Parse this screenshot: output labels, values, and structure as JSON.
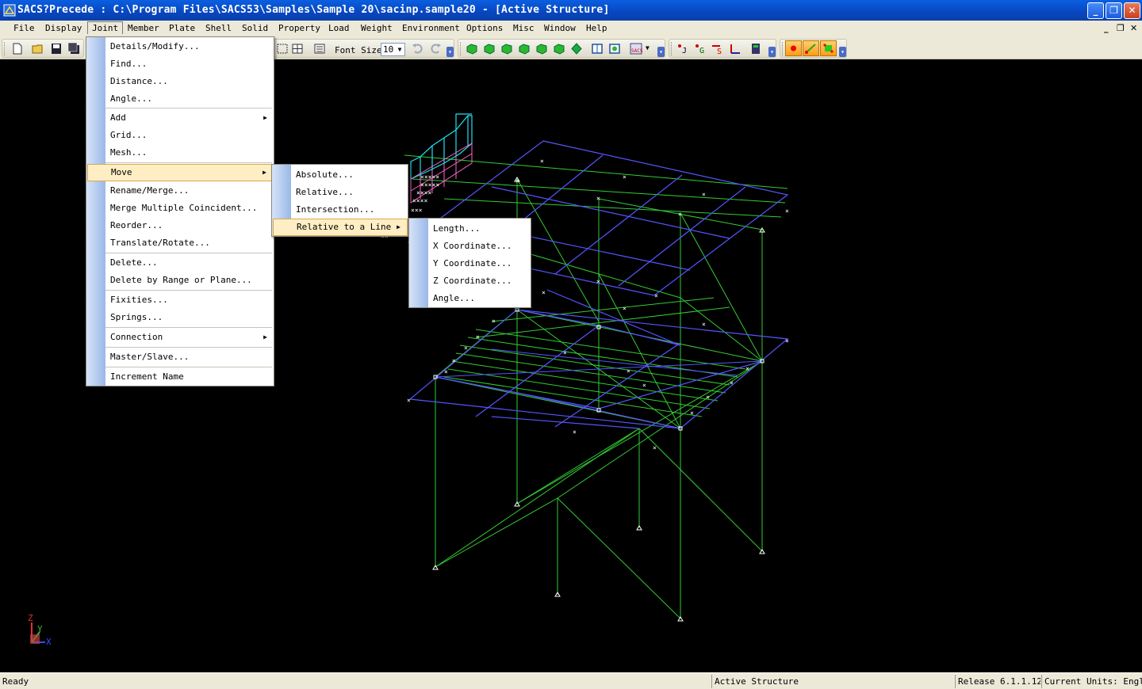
{
  "window": {
    "title": "SACS?Precede :  C:\\Program Files\\SACS53\\Samples\\Sample 20\\sacinp.sample20 - [Active Structure]",
    "minimize": "_",
    "restore": "❐",
    "close": "✕"
  },
  "menubar": {
    "items": [
      "File",
      "Display",
      "Joint",
      "Member",
      "Plate",
      "Shell",
      "Solid",
      "Property",
      "Load",
      "Weight",
      "Environment",
      "Options",
      "Misc",
      "Window",
      "Help"
    ],
    "mdi_minimize": "_",
    "mdi_restore": "❐",
    "mdi_close": "✕"
  },
  "toolbar": {
    "font_size_label": "Font Size",
    "font_size_value": "10"
  },
  "joint_menu": {
    "items": [
      "Details/Modify...",
      "Find...",
      "Distance...",
      "Angle...",
      "Add",
      "Grid...",
      "Mesh...",
      "Move",
      "Rename/Merge...",
      "Merge Multiple Coincident...",
      "Reorder...",
      "Translate/Rotate...",
      "Delete...",
      "Delete by Range or Plane...",
      "Fixities...",
      "Springs...",
      "Connection",
      "Master/Slave...",
      "Increment Name"
    ],
    "highlighted": "Move"
  },
  "move_menu": {
    "items": [
      "Absolute...",
      "Relative...",
      "Intersection...",
      "Relative to a Line"
    ],
    "highlighted": "Relative to a Line"
  },
  "relative_line_menu": {
    "items": [
      "Length...",
      "X Coordinate...",
      "Y Coordinate...",
      "Z Coordinate...",
      "Angle..."
    ]
  },
  "axes": {
    "z": "Z",
    "y": "Y",
    "x": "X"
  },
  "statusbar": {
    "ready": "Ready",
    "mode": "Active Structure",
    "release": "Release 6.1.1.12",
    "units": "Current Units: English"
  },
  "colors": {
    "green_members": "#33cc33",
    "blue_members": "#5555ff",
    "cyan_members": "#22e0f0",
    "pink_members": "#ff66cc",
    "title_blue": "#0846c0",
    "menu_highlight": "#ffeec4"
  }
}
